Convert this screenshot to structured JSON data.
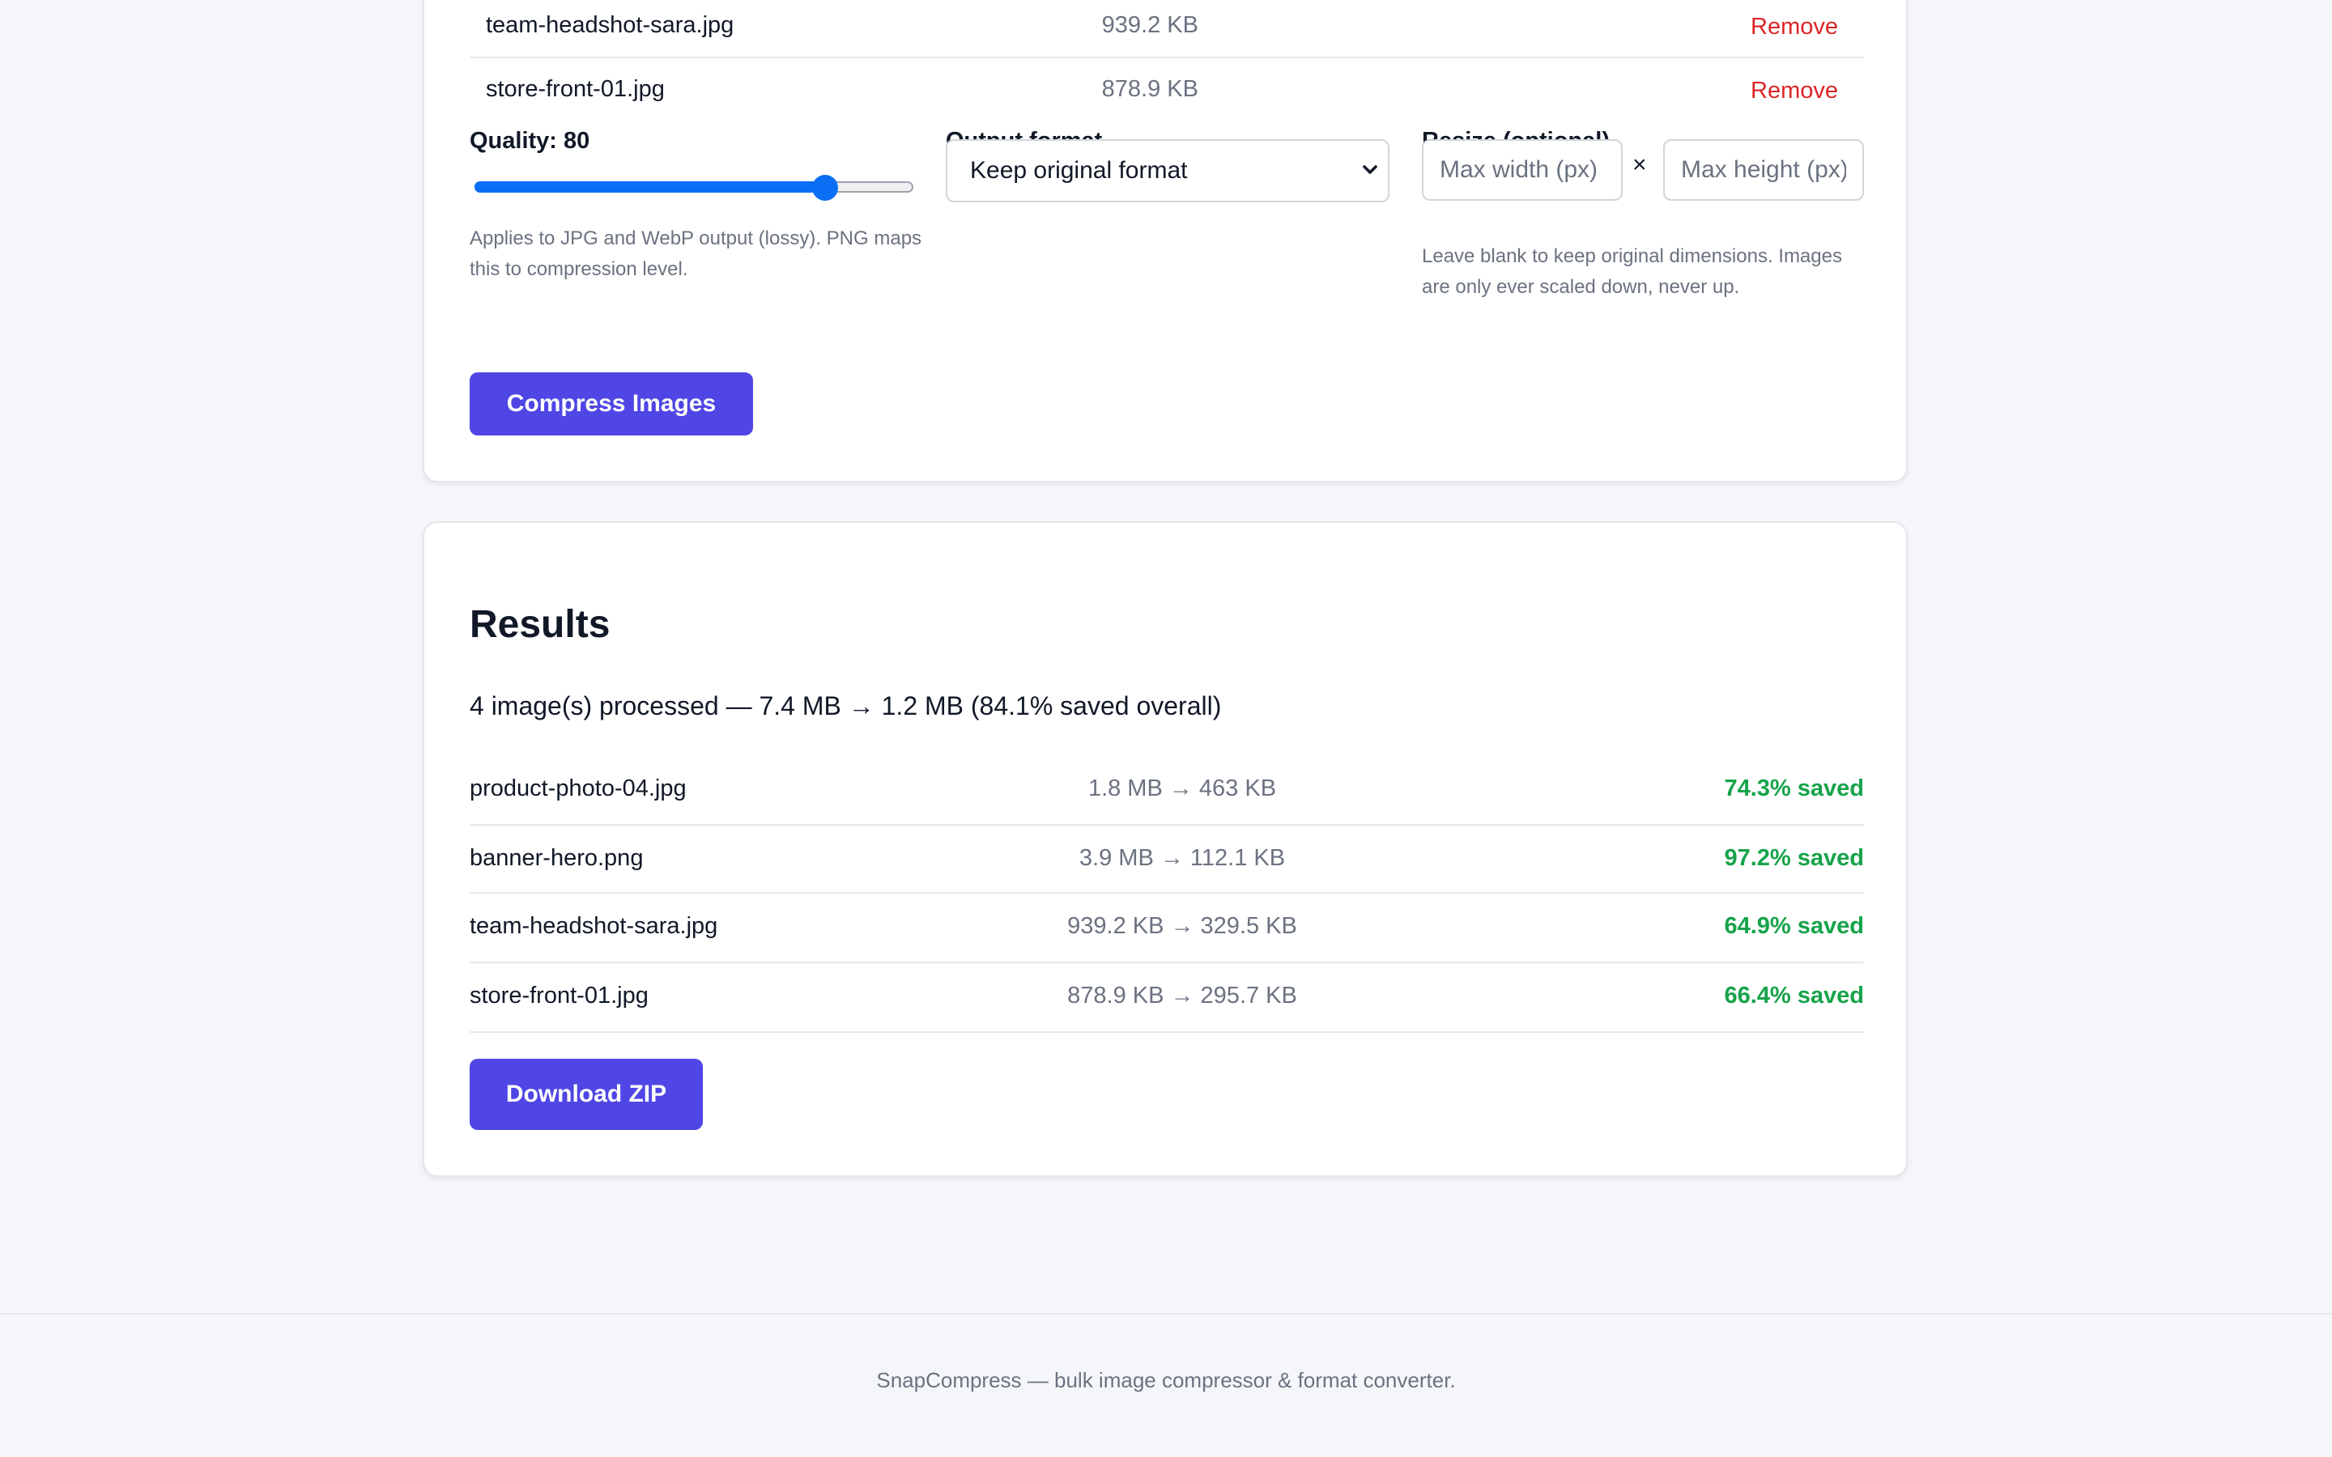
{
  "upload": {
    "files": [
      {
        "name": "team-headshot-sara.jpg",
        "size": "939.2 KB",
        "remove_label": "Remove"
      },
      {
        "name": "store-front-01.jpg",
        "size": "878.9 KB",
        "remove_label": "Remove"
      }
    ]
  },
  "settings": {
    "quality": {
      "label": "Quality: 80",
      "value": 80,
      "min": 1,
      "max": 100,
      "hint": "Applies to JPG and WebP output (lossy). PNG maps this to compression level."
    },
    "output_format": {
      "label": "Output format",
      "selected": "Keep original format"
    },
    "resize": {
      "label": "Resize (optional)",
      "width_placeholder": "Max width (px)",
      "height_placeholder": "Max height (px)",
      "separator": "×",
      "hint": "Leave blank to keep original dimensions. Images are only ever scaled down, never up."
    },
    "compress_label": "Compress Images"
  },
  "results": {
    "title": "Results",
    "summary": "4 image(s) processed — 7.4 MB → 1.2 MB (84.1% saved overall)",
    "rows": [
      {
        "name": "product-photo-04.jpg",
        "sizes": "1.8 MB → 463 KB",
        "saved": "74.3% saved"
      },
      {
        "name": "banner-hero.png",
        "sizes": "3.9 MB → 112.1 KB",
        "saved": "97.2% saved"
      },
      {
        "name": "team-headshot-sara.jpg",
        "sizes": "939.2 KB → 329.5 KB",
        "saved": "64.9% saved"
      },
      {
        "name": "store-front-01.jpg",
        "sizes": "878.9 KB → 295.7 KB",
        "saved": "66.4% saved"
      }
    ],
    "download_label": "Download ZIP"
  },
  "footer": {
    "text": "SnapCompress — bulk image compressor & format converter."
  },
  "colors": {
    "accent": "#4f46e5",
    "slider": "#0b6ff5",
    "danger": "#dc2626",
    "success": "#16a34a"
  },
  "icons": {
    "select_chevron": "chevron-down-icon"
  }
}
